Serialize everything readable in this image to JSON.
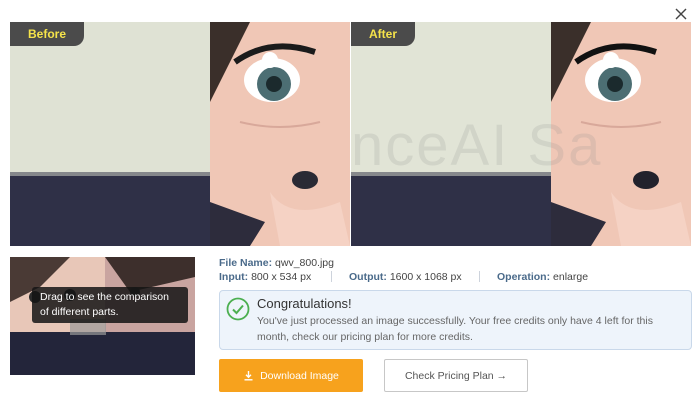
{
  "dialog": {
    "close_icon": "close-icon"
  },
  "compare": {
    "before_label": "Before",
    "after_label": "After",
    "watermark_text": "nceAI Sa"
  },
  "thumbnail": {
    "tooltip": "Drag to see the comparison of different parts."
  },
  "file_info": {
    "file_name_label": "File Name:",
    "file_name_value": "qwv_800.jpg",
    "input_label": "Input:",
    "input_value": "800 x 534 px",
    "output_label": "Output:",
    "output_value": "1600 x 1068 px",
    "operation_label": "Operation:",
    "operation_value": "enlarge"
  },
  "notice": {
    "title": "Congratulations!",
    "message": "You've just processed an image successfully. Your free credits only have 4 left for this month, check our pricing plan for more credits.",
    "icon": "check-circle-icon",
    "color": "#4caf50"
  },
  "actions": {
    "download_label": "Download Image",
    "download_icon": "download-icon",
    "pricing_label": "Check Pricing Plan →",
    "accent_color": "#f7a21d"
  }
}
